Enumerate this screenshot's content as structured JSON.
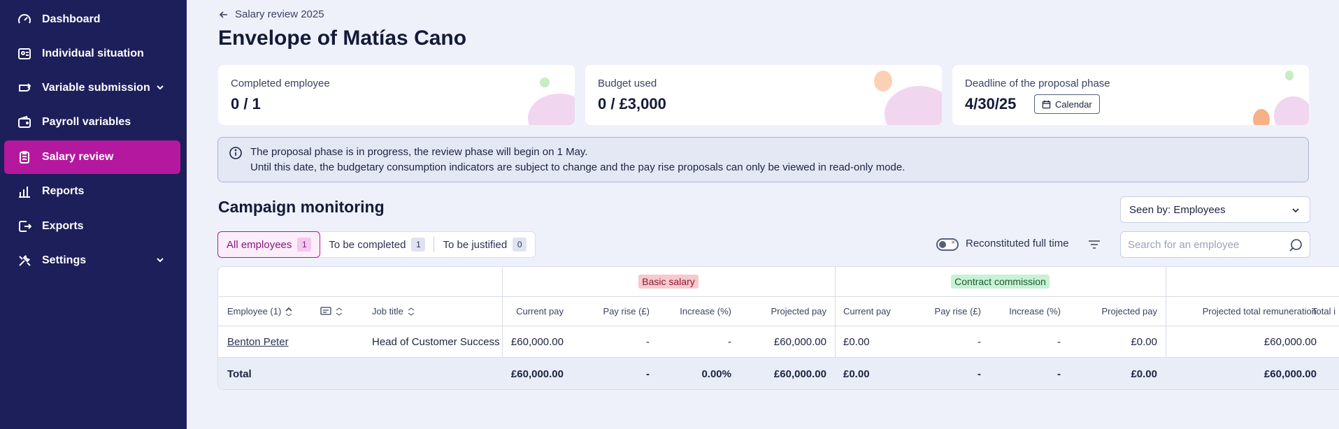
{
  "sidebar": {
    "items": [
      {
        "label": "Dashboard",
        "icon": "dashboard-icon"
      },
      {
        "label": "Individual situation",
        "icon": "individual-icon"
      },
      {
        "label": "Variable submission",
        "icon": "variable-icon"
      },
      {
        "label": "Payroll variables",
        "icon": "wallet-icon"
      },
      {
        "label": "Salary review",
        "icon": "clipboard-icon"
      },
      {
        "label": "Reports",
        "icon": "chart-icon"
      },
      {
        "label": "Exports",
        "icon": "export-icon"
      },
      {
        "label": "Settings",
        "icon": "tools-icon"
      }
    ],
    "active_color": "#b4189e",
    "bg_color": "#1c1f5a"
  },
  "breadcrumb": "Salary review 2025",
  "page_title": "Envelope of Matías Cano",
  "cards": {
    "completed": {
      "label": "Completed employee",
      "value": "0 / 1"
    },
    "budget": {
      "label": "Budget used",
      "value": "0 / £3,000"
    },
    "deadline": {
      "label": "Deadline of the proposal phase",
      "value": "4/30/25",
      "button": "Calendar"
    }
  },
  "info": {
    "line1": "The proposal phase is in progress, the review phase will begin on 1 May.",
    "line2": "Until this date, the budgetary consumption indicators are subject to change and the pay rise proposals can only be viewed in read-only mode."
  },
  "section_title": "Campaign monitoring",
  "seen_by": "Seen by: Employees",
  "tabs": [
    {
      "label": "All employees",
      "count": "1"
    },
    {
      "label": "To be completed",
      "count": "1"
    },
    {
      "label": "To be justified",
      "count": "0"
    }
  ],
  "toggle_label": "Reconstituted full time",
  "search_placeholder": "Search for an employee",
  "table": {
    "groups": {
      "basic": "Basic salary",
      "commission": "Contract commission"
    },
    "headers": {
      "employee": "Employee (1)",
      "job": "Job title",
      "current_pay": "Current pay",
      "pay_rise": "Pay rise (£)",
      "increase": "Increase (%)",
      "projected_pay": "Projected pay",
      "current_pay2": "Current pay",
      "pay_rise2": "Pay rise (£)",
      "increase2": "Increase (%)",
      "projected_pay2": "Projected pay",
      "projected_total": "Projected total remuneration",
      "total_cut": "Total i"
    },
    "row": {
      "employee": "Benton Peter",
      "job": "Head of Customer Success",
      "current_pay": "£60,000.00",
      "pay_rise": "-",
      "increase": "-",
      "projected_pay": "£60,000.00",
      "current_pay2": "£0.00",
      "pay_rise2": "-",
      "increase2": "-",
      "projected_pay2": "£0.00",
      "projected_total": "£60,000.00"
    },
    "total": {
      "label": "Total",
      "current_pay": "£60,000.00",
      "pay_rise": "-",
      "increase": "0.00%",
      "projected_pay": "£60,000.00",
      "current_pay2": "£0.00",
      "pay_rise2": "-",
      "increase2": "-",
      "projected_pay2": "£0.00",
      "projected_total": "£60,000.00"
    }
  }
}
